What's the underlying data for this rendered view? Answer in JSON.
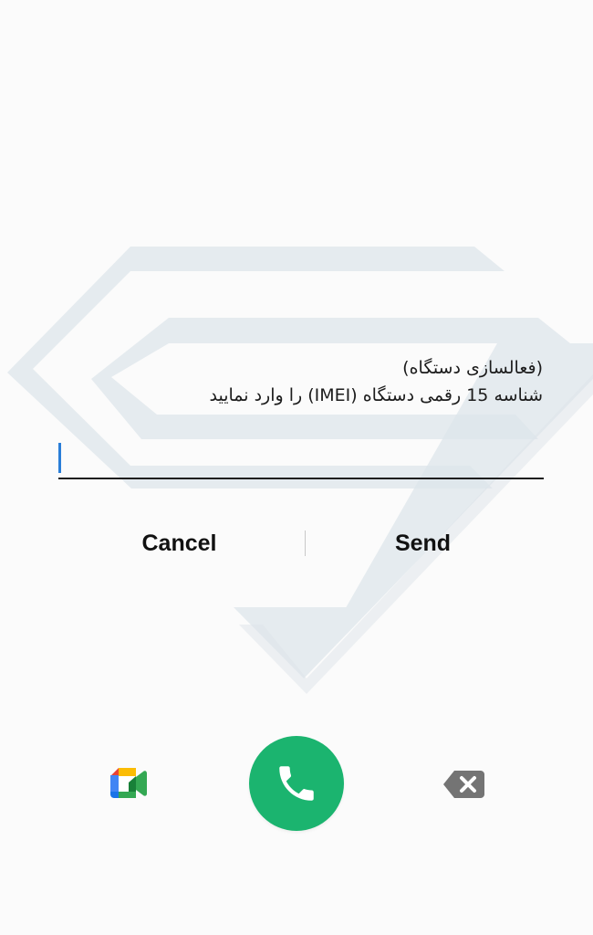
{
  "dialog": {
    "title": "(فعالسازی دستگاه)",
    "message": "شناسه 15 رقمی دستگاه (IMEI) را وارد نمایید",
    "input": {
      "value": "",
      "placeholder": ""
    },
    "cancel_label": "Cancel",
    "send_label": "Send"
  },
  "dialer": {
    "video_call_icon": "google-meet-icon",
    "call_icon": "phone-icon",
    "delete_icon": "backspace-icon"
  },
  "colors": {
    "background": "#fbfbfb",
    "call_button": "#1bb46f",
    "caret": "#2a7ed8",
    "watermark": "#dde4ea",
    "delete_key": "#747474"
  },
  "icons": {
    "watermark": "brand-logo-watermark"
  }
}
